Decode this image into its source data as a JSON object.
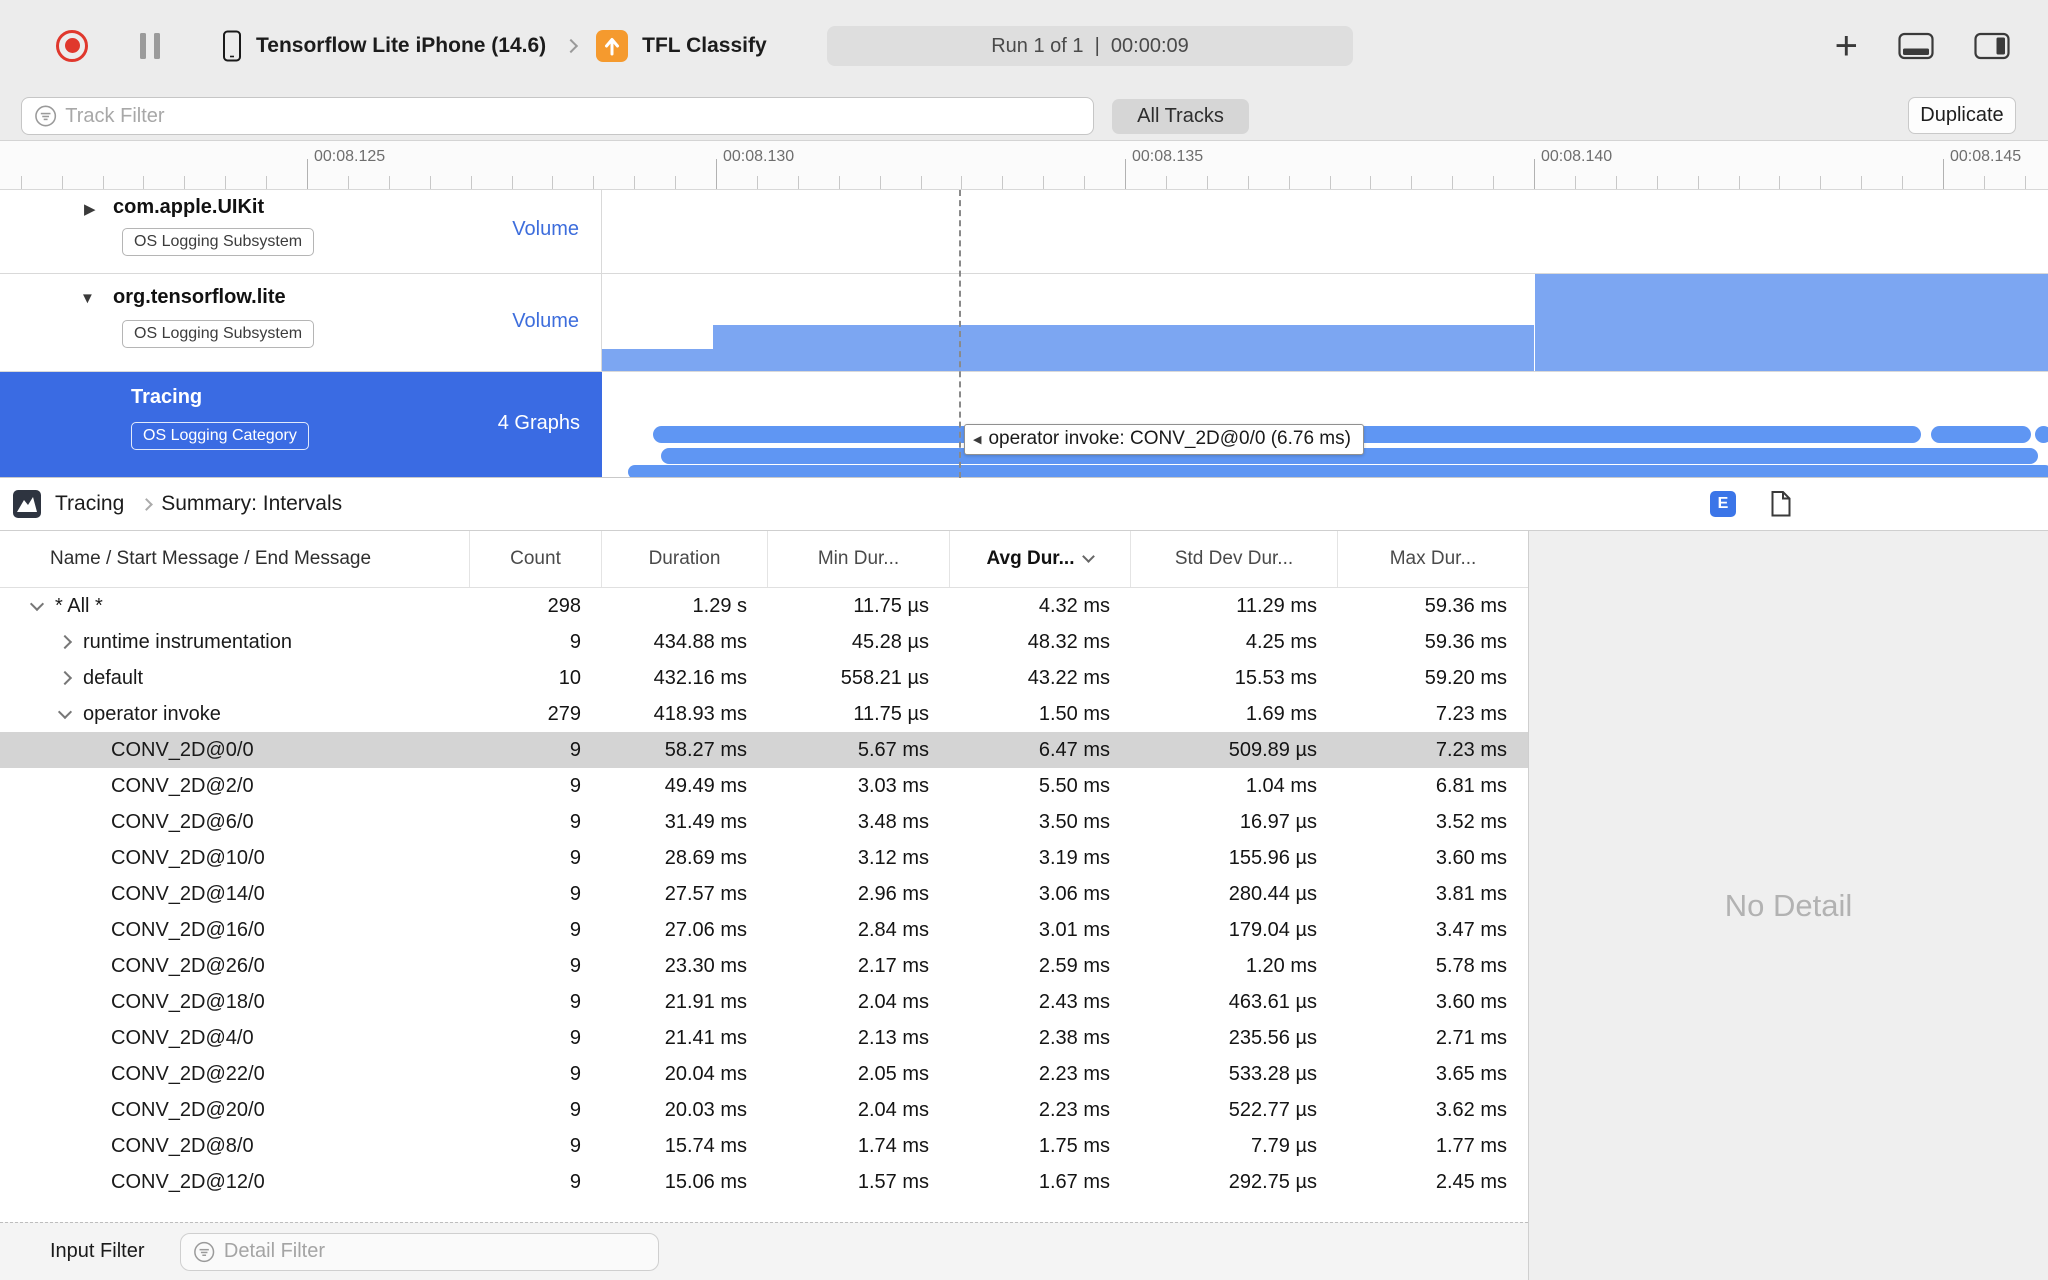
{
  "colors": {
    "accent_blue": "#3A6BE3",
    "volume_fill": "#7CA6F2",
    "interval_fill": "#5F96F3",
    "selected_row_gray": "#D4D4D4",
    "record_red": "#E0382D"
  },
  "toolbar": {
    "device_name": "Tensorflow Lite iPhone (14.6)",
    "target_name": "TFL Classify",
    "run_status": "Run 1 of 1  |  00:00:09"
  },
  "filter_bar": {
    "track_filter_placeholder": "Track Filter",
    "all_tracks_label": "All Tracks",
    "duplicate_label": "Duplicate"
  },
  "ruler": {
    "tick_labels": [
      "00:08.125",
      "00:08.130",
      "00:08.135",
      "00:08.140",
      "00:08.145"
    ]
  },
  "tracks": [
    {
      "name": "com.apple.UIKit",
      "badge": "OS Logging Subsystem",
      "meta": "Volume",
      "disclosure": "collapsed",
      "selected": false
    },
    {
      "name": "org.tensorflow.lite",
      "badge": "OS Logging Subsystem",
      "meta": "Volume",
      "disclosure": "expanded",
      "selected": false
    },
    {
      "name": "Tracing",
      "badge": "OS Logging Category",
      "meta": "4 Graphs",
      "disclosure": "none",
      "selected": true
    }
  ],
  "timeline": {
    "tooltip": "operator invoke: CONV_2D@0/0 (6.76 ms)",
    "volume_segments": [
      {
        "x_frac": 0.0,
        "w_frac": 0.077,
        "h_frac": 0.23
      },
      {
        "x_frac": 0.077,
        "w_frac": 0.568,
        "h_frac": 0.47
      },
      {
        "x_frac": 0.645,
        "w_frac": 0.355,
        "h_frac": 1.0
      }
    ],
    "interval_rows": [
      {
        "y": 54,
        "h": 17,
        "spans": [
          {
            "x_frac": 0.035,
            "w_frac": 0.877
          },
          {
            "x_frac": 0.919,
            "w_frac": 0.069
          },
          {
            "x_frac": 0.991,
            "w_frac": 0.012
          }
        ]
      },
      {
        "y": 76,
        "h": 16,
        "spans": [
          {
            "x_frac": 0.041,
            "w_frac": 0.952
          }
        ]
      },
      {
        "y": 93,
        "h": 14,
        "spans": [
          {
            "x_frac": 0.018,
            "w_frac": 0.985
          }
        ]
      }
    ]
  },
  "detail_header": {
    "breadcrumb_root": "Tracing",
    "breadcrumb_page": "Summary: Intervals",
    "expand_button_label": "E"
  },
  "table": {
    "columns": [
      "Name / Start Message / End Message",
      "Count",
      "Duration",
      "Min Dur...",
      "Avg Dur...",
      "Std Dev Dur...",
      "Max Dur..."
    ],
    "sorted_column": "Avg Dur...",
    "rows": [
      {
        "name": "* All *",
        "count": "298",
        "duration": "1.29 s",
        "min": "11.75 µs",
        "avg": "4.32 ms",
        "std_dev": "11.29 ms",
        "max": "59.36 ms",
        "level": 1,
        "disclosure": "expanded",
        "selected": false
      },
      {
        "name": "runtime instrumentation",
        "count": "9",
        "duration": "434.88 ms",
        "min": "45.28 µs",
        "avg": "48.32 ms",
        "std_dev": "4.25 ms",
        "max": "59.36 ms",
        "level": 2,
        "disclosure": "collapsed",
        "selected": false
      },
      {
        "name": "default",
        "count": "10",
        "duration": "432.16 ms",
        "min": "558.21 µs",
        "avg": "43.22 ms",
        "std_dev": "15.53 ms",
        "max": "59.20 ms",
        "level": 2,
        "disclosure": "collapsed",
        "selected": false
      },
      {
        "name": "operator invoke",
        "count": "279",
        "duration": "418.93 ms",
        "min": "11.75 µs",
        "avg": "1.50 ms",
        "std_dev": "1.69 ms",
        "max": "7.23 ms",
        "level": 2,
        "disclosure": "expanded",
        "selected": false
      },
      {
        "name": "CONV_2D@0/0",
        "count": "9",
        "duration": "58.27 ms",
        "min": "5.67 ms",
        "avg": "6.47 ms",
        "std_dev": "509.89 µs",
        "max": "7.23 ms",
        "level": 3,
        "disclosure": null,
        "selected": true
      },
      {
        "name": "CONV_2D@2/0",
        "count": "9",
        "duration": "49.49 ms",
        "min": "3.03 ms",
        "avg": "5.50 ms",
        "std_dev": "1.04 ms",
        "max": "6.81 ms",
        "level": 3,
        "disclosure": null,
        "selected": false
      },
      {
        "name": "CONV_2D@6/0",
        "count": "9",
        "duration": "31.49 ms",
        "min": "3.48 ms",
        "avg": "3.50 ms",
        "std_dev": "16.97 µs",
        "max": "3.52 ms",
        "level": 3,
        "disclosure": null,
        "selected": false
      },
      {
        "name": "CONV_2D@10/0",
        "count": "9",
        "duration": "28.69 ms",
        "min": "3.12 ms",
        "avg": "3.19 ms",
        "std_dev": "155.96 µs",
        "max": "3.60 ms",
        "level": 3,
        "disclosure": null,
        "selected": false
      },
      {
        "name": "CONV_2D@14/0",
        "count": "9",
        "duration": "27.57 ms",
        "min": "2.96 ms",
        "avg": "3.06 ms",
        "std_dev": "280.44 µs",
        "max": "3.81 ms",
        "level": 3,
        "disclosure": null,
        "selected": false
      },
      {
        "name": "CONV_2D@16/0",
        "count": "9",
        "duration": "27.06 ms",
        "min": "2.84 ms",
        "avg": "3.01 ms",
        "std_dev": "179.04 µs",
        "max": "3.47 ms",
        "level": 3,
        "disclosure": null,
        "selected": false
      },
      {
        "name": "CONV_2D@26/0",
        "count": "9",
        "duration": "23.30 ms",
        "min": "2.17 ms",
        "avg": "2.59 ms",
        "std_dev": "1.20 ms",
        "max": "5.78 ms",
        "level": 3,
        "disclosure": null,
        "selected": false
      },
      {
        "name": "CONV_2D@18/0",
        "count": "9",
        "duration": "21.91 ms",
        "min": "2.04 ms",
        "avg": "2.43 ms",
        "std_dev": "463.61 µs",
        "max": "3.60 ms",
        "level": 3,
        "disclosure": null,
        "selected": false
      },
      {
        "name": "CONV_2D@4/0",
        "count": "9",
        "duration": "21.41 ms",
        "min": "2.13 ms",
        "avg": "2.38 ms",
        "std_dev": "235.56 µs",
        "max": "2.71 ms",
        "level": 3,
        "disclosure": null,
        "selected": false
      },
      {
        "name": "CONV_2D@22/0",
        "count": "9",
        "duration": "20.04 ms",
        "min": "2.05 ms",
        "avg": "2.23 ms",
        "std_dev": "533.28 µs",
        "max": "3.65 ms",
        "level": 3,
        "disclosure": null,
        "selected": false
      },
      {
        "name": "CONV_2D@20/0",
        "count": "9",
        "duration": "20.03 ms",
        "min": "2.04 ms",
        "avg": "2.23 ms",
        "std_dev": "522.77 µs",
        "max": "3.62 ms",
        "level": 3,
        "disclosure": null,
        "selected": false
      },
      {
        "name": "CONV_2D@8/0",
        "count": "9",
        "duration": "15.74 ms",
        "min": "1.74 ms",
        "avg": "1.75 ms",
        "std_dev": "7.79 µs",
        "max": "1.77 ms",
        "level": 3,
        "disclosure": null,
        "selected": false
      },
      {
        "name": "CONV_2D@12/0",
        "count": "9",
        "duration": "15.06 ms",
        "min": "1.57 ms",
        "avg": "1.67 ms",
        "std_dev": "292.75 µs",
        "max": "2.45 ms",
        "level": 3,
        "disclosure": null,
        "selected": false
      }
    ]
  },
  "detail_pane": {
    "empty_text": "No Detail"
  },
  "bottom_bar": {
    "label": "Input Filter",
    "detail_filter_placeholder": "Detail Filter"
  }
}
